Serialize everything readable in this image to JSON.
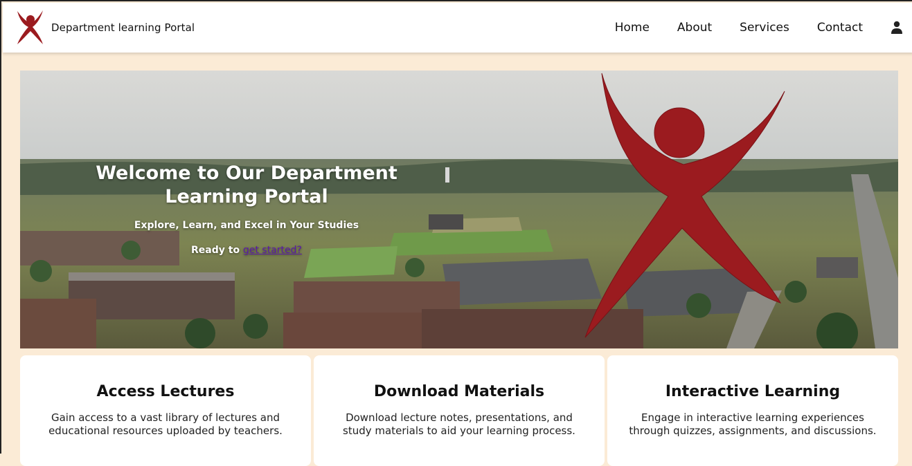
{
  "header": {
    "brand_name": "Department learning Portal",
    "nav": [
      "Home",
      "About",
      "Services",
      "Contact"
    ],
    "accent": "#9b1b1f"
  },
  "hero": {
    "title": "Welcome to Our Department Learning Portal",
    "subtitle": "Explore, Learn, and Excel in Your Studies",
    "cta_prefix": "Ready to ",
    "cta_link": "get started?"
  },
  "cards": [
    {
      "title": "Access Lectures",
      "text": "Gain access to a vast library of lectures and educational resources uploaded by teachers."
    },
    {
      "title": "Download Materials",
      "text": "Download lecture notes, presentations, and study materials to aid your learning process."
    },
    {
      "title": "Interactive Learning",
      "text": "Engage in interactive learning experiences through quizzes, assignments, and discussions."
    }
  ]
}
